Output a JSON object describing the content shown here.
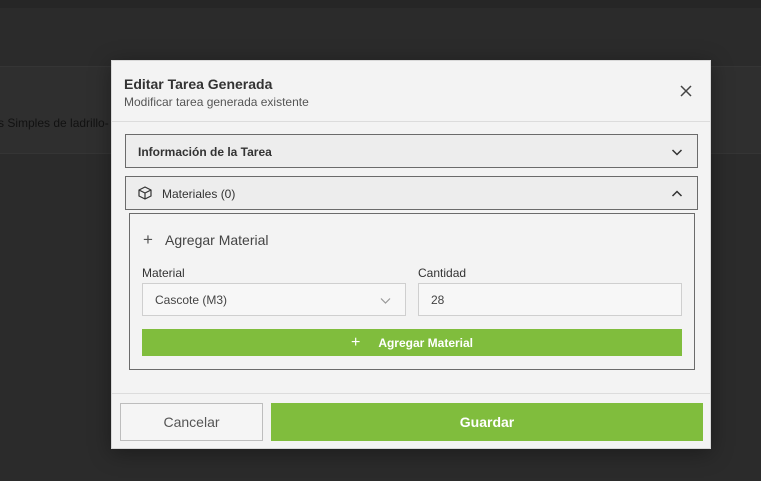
{
  "background": {
    "row_text": "s Simples de ladrillo-"
  },
  "modal": {
    "title": "Editar Tarea Generada",
    "subtitle": "Modificar tarea generada existente",
    "close_icon": "close-icon",
    "sections": {
      "info": {
        "label": "Información de la Tarea",
        "expanded": false
      },
      "materials": {
        "label": "Materiales (0)",
        "icon": "box-icon",
        "expanded": true
      }
    },
    "add_material": {
      "heading": "Agregar Material",
      "material_label": "Material",
      "material_value": "Cascote (M3)",
      "quantity_label": "Cantidad",
      "quantity_value": "28",
      "button_label": "Agregar Material"
    },
    "footer": {
      "cancel_label": "Cancelar",
      "save_label": "Guardar"
    }
  },
  "colors": {
    "accent": "#80bd3d",
    "overlay": "#2b2b2b",
    "modal_bg": "#f3f3f3"
  }
}
